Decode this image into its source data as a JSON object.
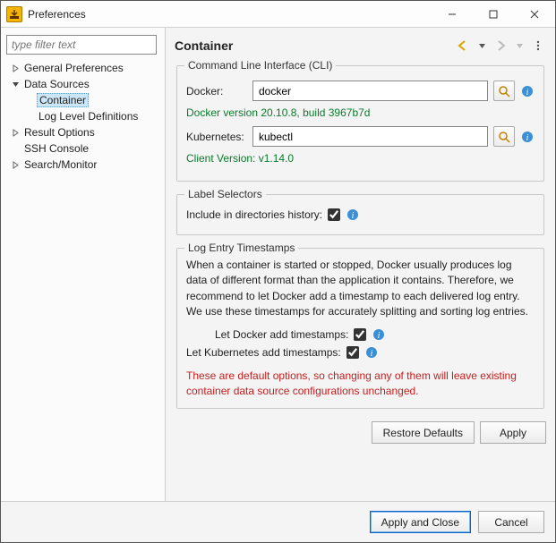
{
  "window": {
    "title": "Preferences"
  },
  "sidebar": {
    "filter_placeholder": "type filter text",
    "items": [
      {
        "label": "General Preferences",
        "expandable": true,
        "expanded": false
      },
      {
        "label": "Data Sources",
        "expandable": true,
        "expanded": true,
        "children": [
          {
            "label": "Container",
            "selected": true
          },
          {
            "label": "Log Level Definitions"
          }
        ]
      },
      {
        "label": "Result Options",
        "expandable": true,
        "expanded": false
      },
      {
        "label": "SSH Console"
      },
      {
        "label": "Search/Monitor",
        "expandable": true,
        "expanded": false
      }
    ]
  },
  "content": {
    "heading": "Container",
    "cli_group": {
      "legend": "Command Line Interface (CLI)",
      "docker_label": "Docker:",
      "docker_value": "docker",
      "docker_version": "Docker version 20.10.8, build 3967b7d",
      "kube_label": "Kubernetes:",
      "kube_value": "kubectl",
      "kube_version": "Client Version: v1.14.0"
    },
    "label_group": {
      "legend": "Label Selectors",
      "checkbox_label": "Include in directories history:"
    },
    "log_group": {
      "legend": "Log Entry Timestamps",
      "description": "When a container is started or stopped, Docker usually produces log data of different format than the application it contains. Therefore, we recommend to let Docker add a timestamp to each delivered log entry. We use these timestamps for accurately splitting and sorting log entries.",
      "docker_ts_label": "Let Docker add timestamps:",
      "kube_ts_label": "Let Kubernetes add timestamps:",
      "warning": "These are default options, so changing any of them will leave existing container data source configurations unchanged."
    },
    "restore_btn": "Restore Defaults",
    "apply_btn": "Apply"
  },
  "footer": {
    "apply_close_btn": "Apply and Close",
    "cancel_btn": "Cancel"
  }
}
